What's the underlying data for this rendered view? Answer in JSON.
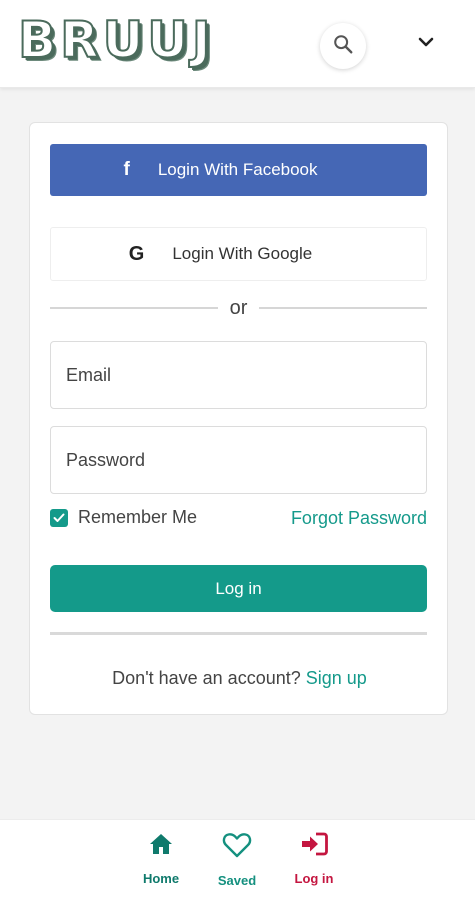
{
  "header": {
    "logo_text": "BRUUJ",
    "search_icon": "search-icon",
    "menu_icon": "chevron-down-icon"
  },
  "login_card": {
    "facebook_button": {
      "icon": "facebook-icon",
      "label": "Login With Facebook"
    },
    "google_button": {
      "icon": "google-icon",
      "label": "Login With Google"
    },
    "divider_text": "or",
    "email_field": {
      "placeholder": "Email",
      "value": ""
    },
    "password_field": {
      "placeholder": "Password",
      "value": ""
    },
    "remember_me": {
      "label": "Remember Me",
      "checked": true
    },
    "forgot_password_link": "Forgot Password",
    "login_button": "Log in",
    "signup_prompt": "Don't have an account?",
    "signup_link": "Sign up"
  },
  "bottom_nav": {
    "items": [
      {
        "icon": "home-icon",
        "label": "Home"
      },
      {
        "icon": "heart-icon",
        "label": "Saved"
      },
      {
        "icon": "login-icon",
        "label": "Log in"
      }
    ]
  },
  "colors": {
    "facebook_blue": "#4567b5",
    "accent_teal": "#149a8a",
    "login_red": "#c41640",
    "logo_green": "#4b6b5c"
  }
}
